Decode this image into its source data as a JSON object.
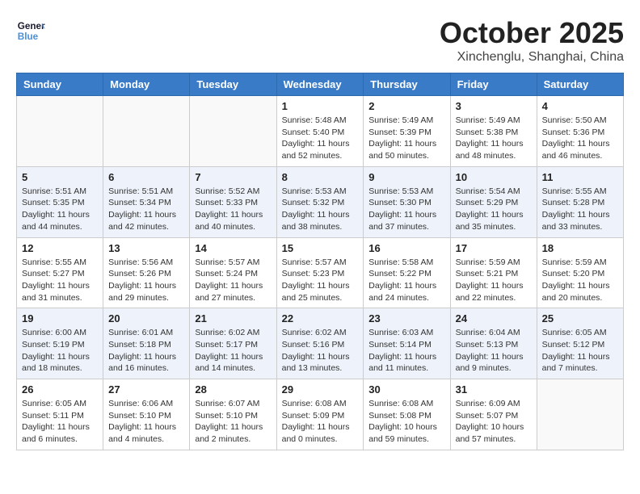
{
  "header": {
    "logo_line1": "General",
    "logo_line2": "Blue",
    "month": "October 2025",
    "location": "Xinchenglu, Shanghai, China"
  },
  "weekdays": [
    "Sunday",
    "Monday",
    "Tuesday",
    "Wednesday",
    "Thursday",
    "Friday",
    "Saturday"
  ],
  "weeks": [
    [
      {
        "day": "",
        "info": ""
      },
      {
        "day": "",
        "info": ""
      },
      {
        "day": "",
        "info": ""
      },
      {
        "day": "1",
        "info": "Sunrise: 5:48 AM\nSunset: 5:40 PM\nDaylight: 11 hours\nand 52 minutes."
      },
      {
        "day": "2",
        "info": "Sunrise: 5:49 AM\nSunset: 5:39 PM\nDaylight: 11 hours\nand 50 minutes."
      },
      {
        "day": "3",
        "info": "Sunrise: 5:49 AM\nSunset: 5:38 PM\nDaylight: 11 hours\nand 48 minutes."
      },
      {
        "day": "4",
        "info": "Sunrise: 5:50 AM\nSunset: 5:36 PM\nDaylight: 11 hours\nand 46 minutes."
      }
    ],
    [
      {
        "day": "5",
        "info": "Sunrise: 5:51 AM\nSunset: 5:35 PM\nDaylight: 11 hours\nand 44 minutes."
      },
      {
        "day": "6",
        "info": "Sunrise: 5:51 AM\nSunset: 5:34 PM\nDaylight: 11 hours\nand 42 minutes."
      },
      {
        "day": "7",
        "info": "Sunrise: 5:52 AM\nSunset: 5:33 PM\nDaylight: 11 hours\nand 40 minutes."
      },
      {
        "day": "8",
        "info": "Sunrise: 5:53 AM\nSunset: 5:32 PM\nDaylight: 11 hours\nand 38 minutes."
      },
      {
        "day": "9",
        "info": "Sunrise: 5:53 AM\nSunset: 5:30 PM\nDaylight: 11 hours\nand 37 minutes."
      },
      {
        "day": "10",
        "info": "Sunrise: 5:54 AM\nSunset: 5:29 PM\nDaylight: 11 hours\nand 35 minutes."
      },
      {
        "day": "11",
        "info": "Sunrise: 5:55 AM\nSunset: 5:28 PM\nDaylight: 11 hours\nand 33 minutes."
      }
    ],
    [
      {
        "day": "12",
        "info": "Sunrise: 5:55 AM\nSunset: 5:27 PM\nDaylight: 11 hours\nand 31 minutes."
      },
      {
        "day": "13",
        "info": "Sunrise: 5:56 AM\nSunset: 5:26 PM\nDaylight: 11 hours\nand 29 minutes."
      },
      {
        "day": "14",
        "info": "Sunrise: 5:57 AM\nSunset: 5:24 PM\nDaylight: 11 hours\nand 27 minutes."
      },
      {
        "day": "15",
        "info": "Sunrise: 5:57 AM\nSunset: 5:23 PM\nDaylight: 11 hours\nand 25 minutes."
      },
      {
        "day": "16",
        "info": "Sunrise: 5:58 AM\nSunset: 5:22 PM\nDaylight: 11 hours\nand 24 minutes."
      },
      {
        "day": "17",
        "info": "Sunrise: 5:59 AM\nSunset: 5:21 PM\nDaylight: 11 hours\nand 22 minutes."
      },
      {
        "day": "18",
        "info": "Sunrise: 5:59 AM\nSunset: 5:20 PM\nDaylight: 11 hours\nand 20 minutes."
      }
    ],
    [
      {
        "day": "19",
        "info": "Sunrise: 6:00 AM\nSunset: 5:19 PM\nDaylight: 11 hours\nand 18 minutes."
      },
      {
        "day": "20",
        "info": "Sunrise: 6:01 AM\nSunset: 5:18 PM\nDaylight: 11 hours\nand 16 minutes."
      },
      {
        "day": "21",
        "info": "Sunrise: 6:02 AM\nSunset: 5:17 PM\nDaylight: 11 hours\nand 14 minutes."
      },
      {
        "day": "22",
        "info": "Sunrise: 6:02 AM\nSunset: 5:16 PM\nDaylight: 11 hours\nand 13 minutes."
      },
      {
        "day": "23",
        "info": "Sunrise: 6:03 AM\nSunset: 5:14 PM\nDaylight: 11 hours\nand 11 minutes."
      },
      {
        "day": "24",
        "info": "Sunrise: 6:04 AM\nSunset: 5:13 PM\nDaylight: 11 hours\nand 9 minutes."
      },
      {
        "day": "25",
        "info": "Sunrise: 6:05 AM\nSunset: 5:12 PM\nDaylight: 11 hours\nand 7 minutes."
      }
    ],
    [
      {
        "day": "26",
        "info": "Sunrise: 6:05 AM\nSunset: 5:11 PM\nDaylight: 11 hours\nand 6 minutes."
      },
      {
        "day": "27",
        "info": "Sunrise: 6:06 AM\nSunset: 5:10 PM\nDaylight: 11 hours\nand 4 minutes."
      },
      {
        "day": "28",
        "info": "Sunrise: 6:07 AM\nSunset: 5:10 PM\nDaylight: 11 hours\nand 2 minutes."
      },
      {
        "day": "29",
        "info": "Sunrise: 6:08 AM\nSunset: 5:09 PM\nDaylight: 11 hours\nand 0 minutes."
      },
      {
        "day": "30",
        "info": "Sunrise: 6:08 AM\nSunset: 5:08 PM\nDaylight: 10 hours\nand 59 minutes."
      },
      {
        "day": "31",
        "info": "Sunrise: 6:09 AM\nSunset: 5:07 PM\nDaylight: 10 hours\nand 57 minutes."
      },
      {
        "day": "",
        "info": ""
      }
    ]
  ]
}
